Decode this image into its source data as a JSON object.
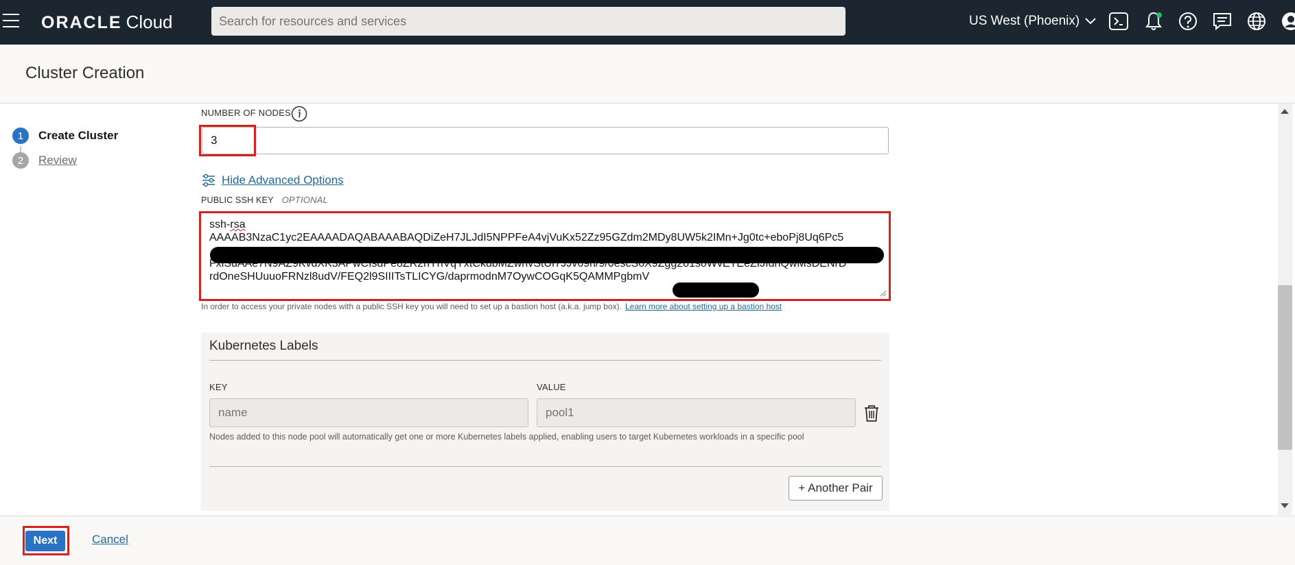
{
  "topbar": {
    "brand": "ORACLE",
    "product": "Cloud",
    "search_placeholder": "Search for resources and services",
    "region": "US West (Phoenix)"
  },
  "header": {
    "title": "Cluster Creation"
  },
  "steps": [
    {
      "num": "1",
      "label": "Create Cluster",
      "active": true
    },
    {
      "num": "2",
      "label": "Review",
      "active": false
    }
  ],
  "form": {
    "nodes_label": "NUMBER OF NODES",
    "nodes_value": "3",
    "advanced_link": "Hide Advanced Options",
    "ssh_label": "PUBLIC SSH KEY",
    "ssh_optional": "OPTIONAL",
    "ssh_line1a": "ssh-",
    "ssh_line1b": "rsa",
    "ssh_line2": "AAAAB3NzaC1yc2EAAAADAQABAAABAQDiZeH7JLJdI5NPPFeA4vjVuKx52Zz95GZdm2MDy8UW5k2IMn+Jg0tc+eboPj8Uq6Pc5",
    "ssh_line4": "FxlSuAAe7N9AZ9KvdXK3APwCIsdPe8ZR2nYnVqYxtCkubMZwnvStUf7JJv69h/9/0escS6X9Zgg2o1soWvETEeZIJIdhQwMsDENrD",
    "ssh_line5": "rdOneSHUuuoFRNzl8udV/FEQ2l9SIIITsTLICYG/daprmodnM7OywCOGqK5QAMMPgbmV",
    "ssh_help": "In order to access your private nodes with a public SSH key you will need to set up a bastion host (a.k.a. jump box).",
    "ssh_help_link": "Learn more about setting up a bastion host"
  },
  "labels": {
    "title": "Kubernetes Labels",
    "key_label": "KEY",
    "value_label": "VALUE",
    "key_placeholder": "name",
    "value_placeholder": "pool1",
    "help": "Nodes added to this node pool will automatically get one or more Kubernetes labels applied, enabling users to target Kubernetes workloads in a specific pool",
    "add_pair": "+ Another Pair"
  },
  "footer": {
    "next": "Next",
    "cancel": "Cancel"
  },
  "colors": {
    "topbar": "#1c2631",
    "link": "#1f6a97",
    "primary": "#2a73c4",
    "highlight": "#d0221f"
  }
}
